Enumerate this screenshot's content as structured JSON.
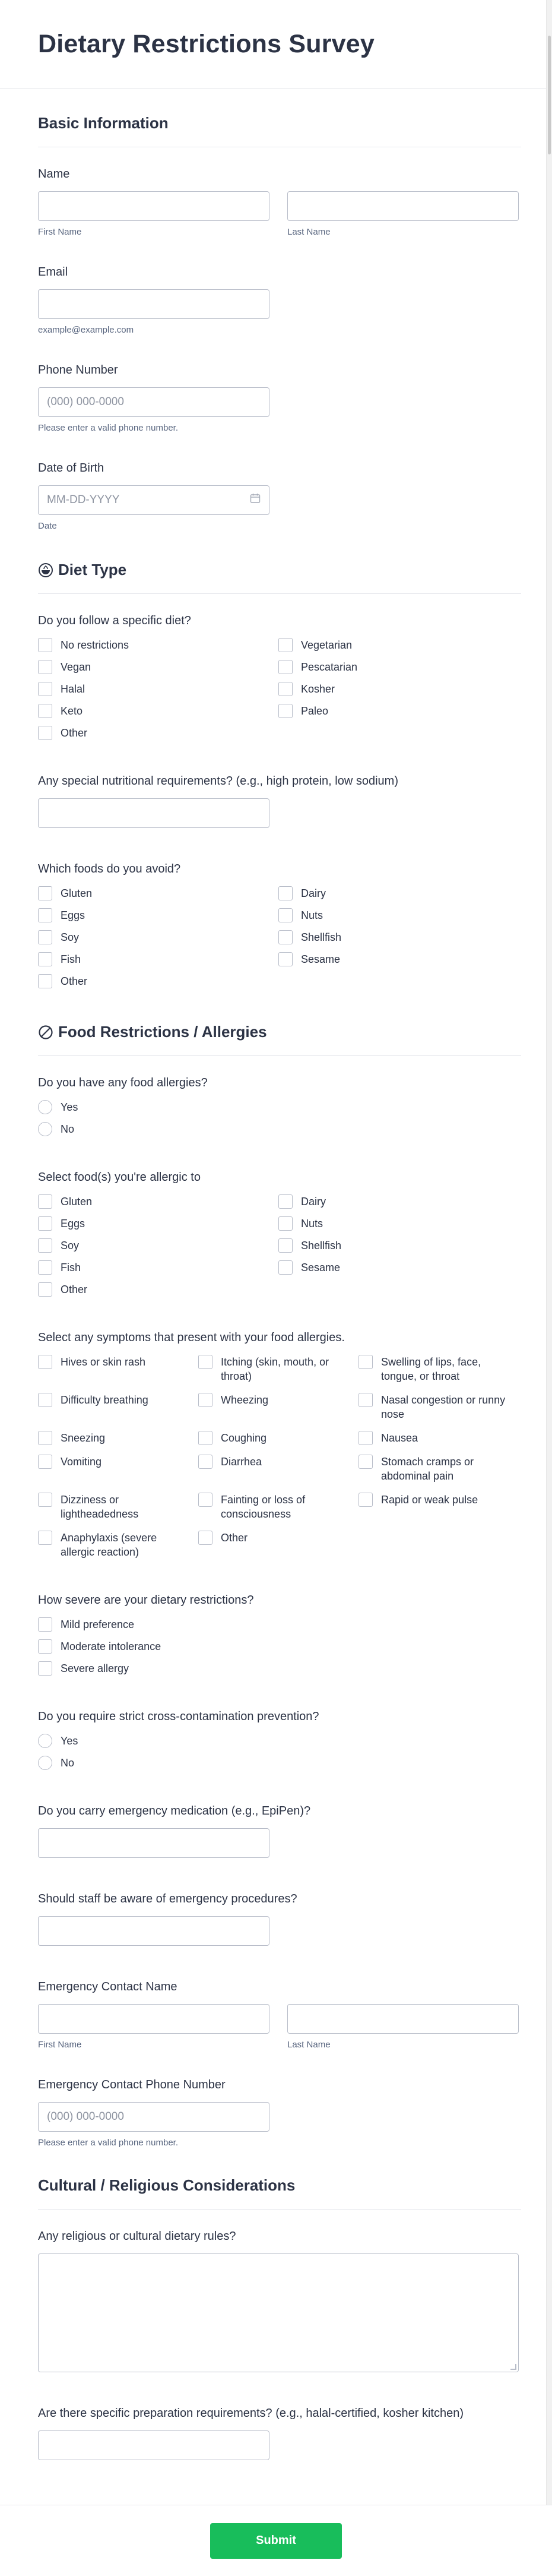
{
  "title": "Dietary Restrictions Survey",
  "basic": {
    "heading": "Basic Information",
    "name_label": "Name",
    "first_name": "First Name",
    "last_name": "Last Name",
    "email_label": "Email",
    "email_sub": "example@example.com",
    "phone_label": "Phone Number",
    "phone_placeholder": "(000) 000-0000",
    "phone_sub": "Please enter a valid phone number.",
    "dob_label": "Date of Birth",
    "dob_placeholder": "MM-DD-YYYY",
    "dob_sub": "Date"
  },
  "diet": {
    "heading": "Diet Type",
    "icon": "vegetable-bowl-icon",
    "q1": "Do you follow a specific diet?",
    "q1_options": [
      "No restrictions",
      "Vegetarian",
      "Vegan",
      "Pescatarian",
      "Halal",
      "Kosher",
      "Keto",
      "Paleo",
      "Other"
    ],
    "q2": "Any special nutritional requirements? (e.g., high protein, low sodium)",
    "q3": "Which foods do you avoid?",
    "q3_options": [
      "Gluten",
      "Dairy",
      "Eggs",
      "Nuts",
      "Soy",
      "Shellfish",
      "Fish",
      "Sesame",
      "Other"
    ]
  },
  "allergy": {
    "heading": "Food Restrictions / Allergies",
    "icon": "prohibited-icon",
    "q1": "Do you have any food allergies?",
    "q1_options": [
      "Yes",
      "No"
    ],
    "q2": "Select food(s) you're allergic to",
    "q2_options": [
      "Gluten",
      "Dairy",
      "Eggs",
      "Nuts",
      "Soy",
      "Shellfish",
      "Fish",
      "Sesame",
      "Other"
    ],
    "q3": "Select any symptoms that present with your food allergies.",
    "q3_options": [
      "Hives or skin rash",
      "Itching (skin, mouth, or throat)",
      "Swelling of lips, face, tongue, or throat",
      "Difficulty breathing",
      "Wheezing",
      "Nasal congestion or runny nose",
      "Sneezing",
      "Coughing",
      "Nausea",
      "Vomiting",
      "Diarrhea",
      "Stomach cramps or abdominal pain",
      "Dizziness or lightheadedness",
      "Fainting or loss of consciousness",
      "Rapid or weak pulse",
      "Anaphylaxis (severe allergic reaction)",
      "Other"
    ],
    "q4": "How severe are your dietary restrictions?",
    "q4_options": [
      "Mild preference",
      "Moderate intolerance",
      "Severe allergy"
    ],
    "q5": "Do you require strict cross-contamination prevention?",
    "q5_options": [
      "Yes",
      "No"
    ],
    "q6": "Do you carry emergency medication (e.g., EpiPen)?",
    "q7": "Should staff be aware of emergency procedures?",
    "q8": "Emergency Contact Name",
    "first_name": "First Name",
    "last_name": "Last Name",
    "q9": "Emergency Contact Phone Number",
    "phone_placeholder": "(000) 000-0000",
    "phone_sub": "Please enter a valid phone number."
  },
  "cultural": {
    "heading": "Cultural / Religious Considerations",
    "q1": "Any religious or cultural dietary rules?",
    "q2": "Are there specific preparation requirements? (e.g., halal-certified, kosher kitchen)"
  },
  "submit_label": "Submit",
  "colors": {
    "accent": "#18bd5b",
    "text": "#2c3345",
    "border": "#b8bdc9"
  }
}
